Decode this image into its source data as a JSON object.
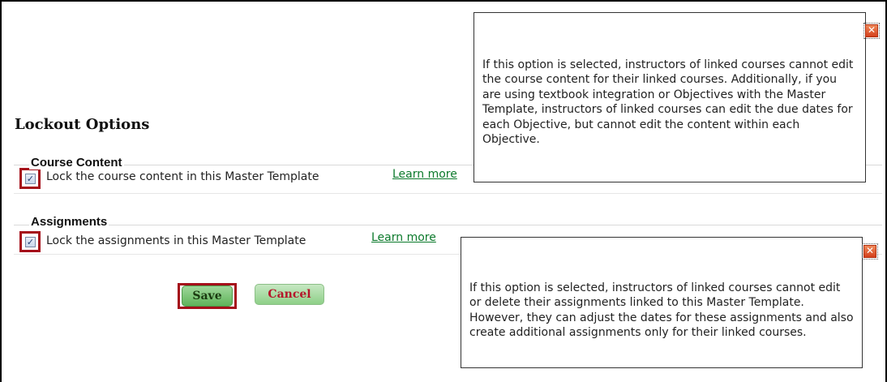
{
  "section": {
    "title": "Lockout Options"
  },
  "course_content": {
    "group_label": "Course Content",
    "checkbox_label": "Lock the course content in this Master Template",
    "checked": true,
    "learn_more": "Learn more",
    "tooltip": {
      "text": "If this option is selected, instructors of linked courses cannot edit the course content for their linked courses. Additionally, if you are using textbook integration or Objectives with the Master Template, instructors of linked courses can edit the due dates for each Objective, but cannot edit the content within each Objective.",
      "close_glyph": "✕"
    }
  },
  "assignments": {
    "group_label": "Assignments",
    "checkbox_label": "Lock the assignments in this Master Template",
    "checked": true,
    "learn_more": "Learn more",
    "tooltip": {
      "text": "If this option is selected, instructors of linked courses cannot edit or delete their assignments linked to this Master Template. However, they can adjust the dates for these assignments and also create additional assignments only for their linked courses.",
      "close_glyph": "✕"
    }
  },
  "buttons": {
    "save": "Save",
    "cancel": "Cancel"
  },
  "checkmark_glyph": "✓",
  "colors": {
    "highlight": "#a50f1a",
    "link": "#0c7a2c",
    "cancel_text": "#b5162b",
    "save_bg": "#5fb45a"
  }
}
